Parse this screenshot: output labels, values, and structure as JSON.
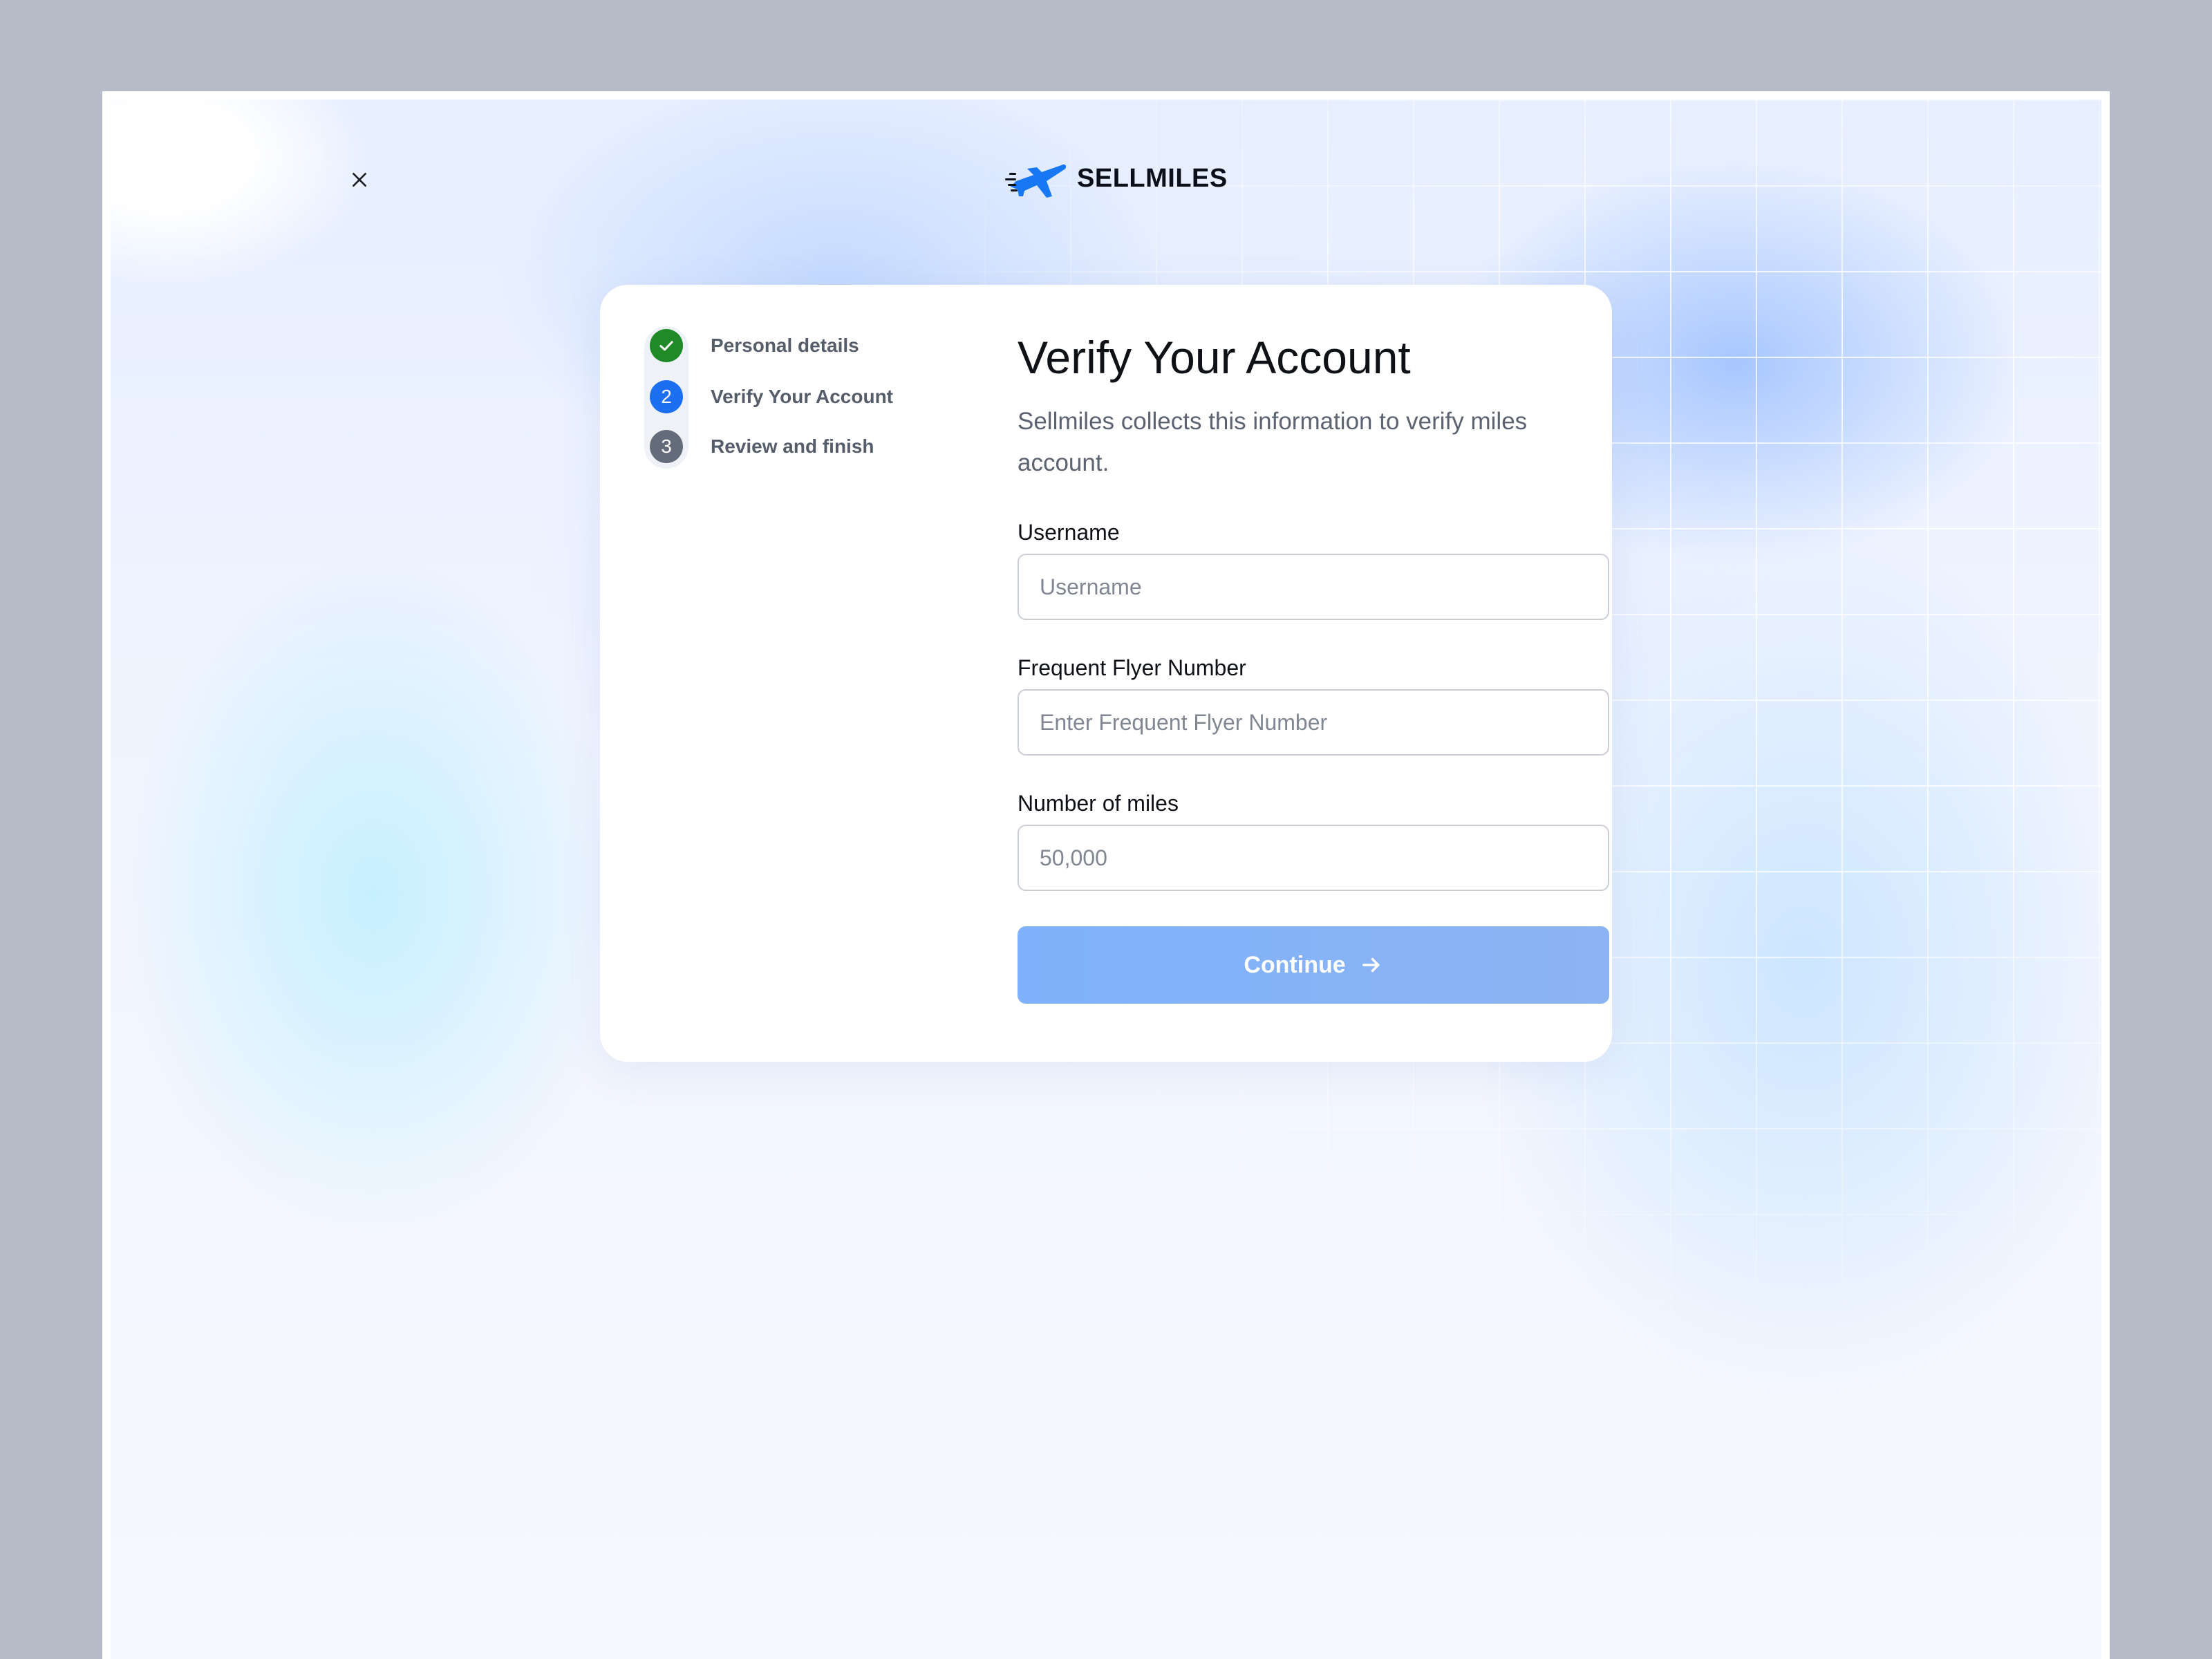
{
  "brand": {
    "name": "SELLMILES",
    "logo_icon": "airplane-logo-icon",
    "color": "#1877f2"
  },
  "close": {
    "icon": "close-icon"
  },
  "steps": [
    {
      "number": "1",
      "label": "Personal details",
      "status": "completed",
      "color": "#1f8a26"
    },
    {
      "number": "2",
      "label": "Verify Your Account",
      "status": "current",
      "color": "#1d6ff2"
    },
    {
      "number": "3",
      "label": "Review and finish",
      "status": "upcoming",
      "color": "#646b7a"
    }
  ],
  "form": {
    "title": "Verify Your Account",
    "subtitle": "Sellmiles collects this information to verify miles account.",
    "fields": [
      {
        "label": "Username",
        "placeholder": "Username",
        "value": ""
      },
      {
        "label": "Frequent Flyer Number",
        "placeholder": "Enter Frequent Flyer Number",
        "value": ""
      },
      {
        "label": "Number of miles",
        "placeholder": "50,000",
        "value": ""
      }
    ],
    "submit": {
      "label": "Continue",
      "icon": "arrow-right-icon",
      "color": "#84b0f6"
    }
  }
}
